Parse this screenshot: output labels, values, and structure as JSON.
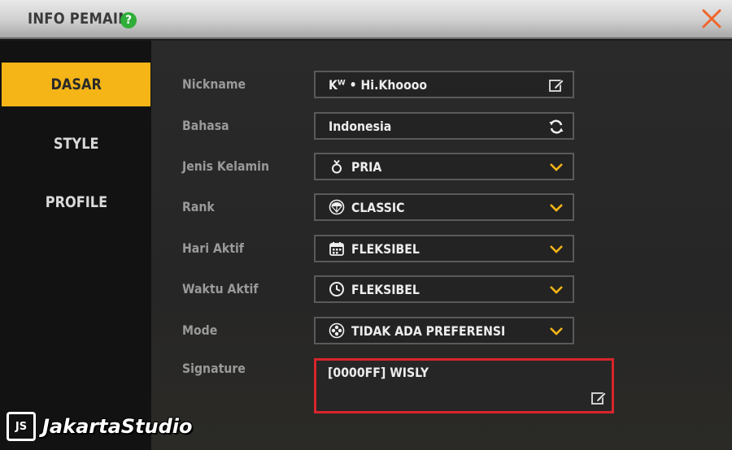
{
  "header": {
    "title": "INFO PEMAIN",
    "help_symbol": "?",
    "close_icon": "close-icon"
  },
  "sidebar": {
    "tabs": [
      {
        "label": "DASAR",
        "active": true
      },
      {
        "label": "STYLE",
        "active": false
      },
      {
        "label": "PROFILE",
        "active": false
      }
    ]
  },
  "form": {
    "nickname": {
      "label": "Nickname",
      "value": "Kᵂ • Hi.Khoooo",
      "icon": "edit-icon"
    },
    "bahasa": {
      "label": "Bahasa",
      "value": "Indonesia",
      "icon": "refresh-icon"
    },
    "jenis_kelamin": {
      "label": "Jenis Kelamin",
      "value": "PRIA",
      "icon": "male-symbol-icon"
    },
    "rank": {
      "label": "Rank",
      "value": "CLASSIC",
      "icon": "parachute-icon"
    },
    "hari_aktif": {
      "label": "Hari Aktif",
      "value": "FLEKSIBEL",
      "icon": "calendar-icon"
    },
    "waktu_aktif": {
      "label": "Waktu Aktif",
      "value": "FLEKSIBEL",
      "icon": "clock-icon"
    },
    "mode": {
      "label": "Mode",
      "value": "TIDAK ADA PREFERENSI",
      "icon": "mode-icon"
    },
    "signature": {
      "label": "Signature",
      "value": "[0000FF] WISLY",
      "icon": "edit-icon"
    }
  },
  "colors": {
    "accent": "#f5b517",
    "close": "#f0642a",
    "highlight_border": "#d8252b",
    "help": "#2fae3a"
  },
  "watermark": {
    "logo_text": "JS",
    "text": "JakartaStudio"
  }
}
